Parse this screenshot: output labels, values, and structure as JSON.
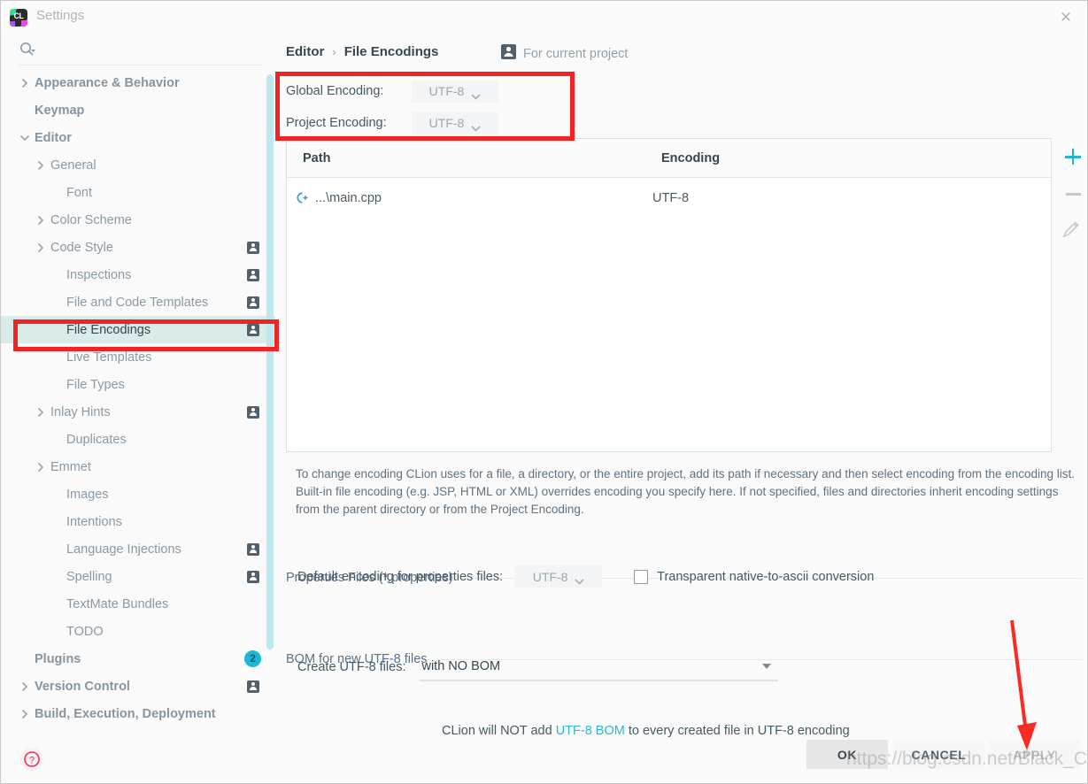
{
  "window": {
    "title": "Settings",
    "logo_text": "CL",
    "close_icon": "close-icon"
  },
  "sidebar": {
    "search_placeholder": "",
    "search_value": "",
    "scrollbar_color": "#bde8ee",
    "items": [
      {
        "label": "Appearance & Behavior",
        "level": 0,
        "twisty": "right",
        "bold": true,
        "badge": ""
      },
      {
        "label": "Keymap",
        "level": 0,
        "twisty": "none",
        "bold": true,
        "badge": ""
      },
      {
        "label": "Editor",
        "level": 0,
        "twisty": "down",
        "bold": true,
        "badge": ""
      },
      {
        "label": "General",
        "level": 1,
        "twisty": "right",
        "bold": false,
        "badge": ""
      },
      {
        "label": "Font",
        "level": 2,
        "twisty": "none",
        "bold": false,
        "badge": ""
      },
      {
        "label": "Color Scheme",
        "level": 1,
        "twisty": "right",
        "bold": false,
        "badge": ""
      },
      {
        "label": "Code Style",
        "level": 1,
        "twisty": "right",
        "bold": false,
        "badge": "person"
      },
      {
        "label": "Inspections",
        "level": 2,
        "twisty": "none",
        "bold": false,
        "badge": "person"
      },
      {
        "label": "File and Code Templates",
        "level": 2,
        "twisty": "none",
        "bold": false,
        "badge": "person"
      },
      {
        "label": "File Encodings",
        "level": 2,
        "twisty": "none",
        "bold": false,
        "badge": "person",
        "selected": true
      },
      {
        "label": "Live Templates",
        "level": 2,
        "twisty": "none",
        "bold": false,
        "badge": ""
      },
      {
        "label": "File Types",
        "level": 2,
        "twisty": "none",
        "bold": false,
        "badge": ""
      },
      {
        "label": "Inlay Hints",
        "level": 1,
        "twisty": "right",
        "bold": false,
        "badge": "person"
      },
      {
        "label": "Duplicates",
        "level": 2,
        "twisty": "none",
        "bold": false,
        "badge": ""
      },
      {
        "label": "Emmet",
        "level": 1,
        "twisty": "right",
        "bold": false,
        "badge": ""
      },
      {
        "label": "Images",
        "level": 2,
        "twisty": "none",
        "bold": false,
        "badge": ""
      },
      {
        "label": "Intentions",
        "level": 2,
        "twisty": "none",
        "bold": false,
        "badge": ""
      },
      {
        "label": "Language Injections",
        "level": 2,
        "twisty": "none",
        "bold": false,
        "badge": "person"
      },
      {
        "label": "Spelling",
        "level": 2,
        "twisty": "none",
        "bold": false,
        "badge": "person"
      },
      {
        "label": "TextMate Bundles",
        "level": 2,
        "twisty": "none",
        "bold": false,
        "badge": ""
      },
      {
        "label": "TODO",
        "level": 2,
        "twisty": "none",
        "bold": false,
        "badge": ""
      },
      {
        "label": "Plugins",
        "level": 0,
        "twisty": "none",
        "bold": true,
        "badge": "count",
        "badge_count": "2"
      },
      {
        "label": "Version Control",
        "level": 0,
        "twisty": "right",
        "bold": true,
        "badge": "person"
      },
      {
        "label": "Build, Execution, Deployment",
        "level": 0,
        "twisty": "right",
        "bold": true,
        "badge": ""
      }
    ],
    "help_icon": "help-icon"
  },
  "main": {
    "breadcrumb": {
      "parent": "Editor",
      "separator": "›",
      "current": "File Encodings"
    },
    "scope": {
      "icon": "person-icon",
      "label": "For current project"
    },
    "encodings": [
      {
        "label": "Global Encoding:",
        "value": "UTF-8"
      },
      {
        "label": "Project Encoding:",
        "value": "UTF-8"
      }
    ],
    "table": {
      "columns": [
        "Path",
        "Encoding"
      ],
      "rows": [
        {
          "icon": "cpp-file-icon",
          "path": "...\\main.cpp",
          "encoding": "UTF-8"
        }
      ],
      "toolbar": [
        {
          "name": "add-button",
          "glyph": "+",
          "enabled": true
        },
        {
          "name": "remove-button",
          "glyph": "−",
          "enabled": false
        },
        {
          "name": "edit-button",
          "glyph": "pencil",
          "enabled": false
        }
      ]
    },
    "description": "To change encoding CLion uses for a file, a directory, or the entire project, add its path if necessary and then select encoding from the encoding list. Built-in file encoding (e.g. JSP, HTML or XML) overrides encoding you specify here. If not specified, files and directories inherit encoding settings from the parent directory or from the Project Encoding.",
    "properties_section": {
      "title": "Properties Files (*.properties)",
      "default_encoding_label": "Default encoding for properties files:",
      "default_encoding_value": "UTF-8",
      "checkbox_label": "Transparent native-to-ascii conversion",
      "checkbox_checked": false
    },
    "bom_section": {
      "title": "BOM for new UTF-8 files",
      "create_label": "Create UTF-8 files:",
      "create_value": "with NO BOM",
      "note_prefix": "CLion will NOT add ",
      "note_link": "UTF-8 BOM",
      "note_suffix": " to every created file in UTF-8 encoding"
    }
  },
  "footer": {
    "ok": "OK",
    "cancel": "CANCEL",
    "apply": "APPLY"
  },
  "annotations": {
    "watermark": "https://blog.csdn.net/Black_Customer",
    "highlight_color": "#f42323",
    "arrow_color": "#fb2a22"
  }
}
